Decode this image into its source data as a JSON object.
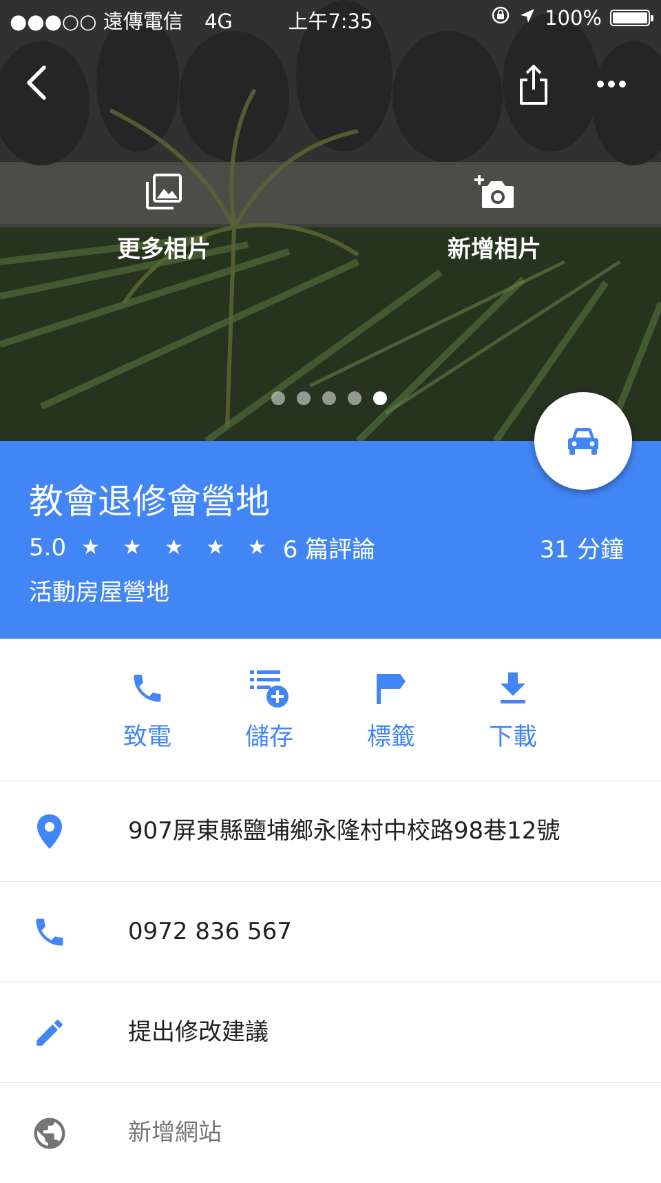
{
  "status_bar": {
    "carrier": "●●●○○ 遠傳電信",
    "network": "4G",
    "time": "上午7:35",
    "battery": "100%"
  },
  "photo": {
    "more_photos_label": "更多相片",
    "add_photo_label": "新增相片",
    "page_count": 5,
    "active_page": 5
  },
  "place": {
    "name": "教會退修會營地",
    "rating": "5.0",
    "stars": "★ ★ ★ ★ ★",
    "reviews": "6 篇評論",
    "travel_time": "31 分鐘",
    "category": "活動房屋營地"
  },
  "actions": [
    {
      "label": "致電",
      "icon": "phone-icon"
    },
    {
      "label": "儲存",
      "icon": "save-list-icon"
    },
    {
      "label": "標籤",
      "icon": "flag-icon"
    },
    {
      "label": "下載",
      "icon": "download-icon"
    }
  ],
  "info": {
    "address": "907屏東縣鹽埔鄉永隆村中校路98巷12號",
    "phone": "0972 836 567",
    "suggest_edit": "提出修改建議",
    "add_website": "新增網站"
  },
  "colors": {
    "accent": "#4285f4",
    "text": "#212121",
    "muted": "#757575",
    "divider": "#e2e2e2"
  }
}
